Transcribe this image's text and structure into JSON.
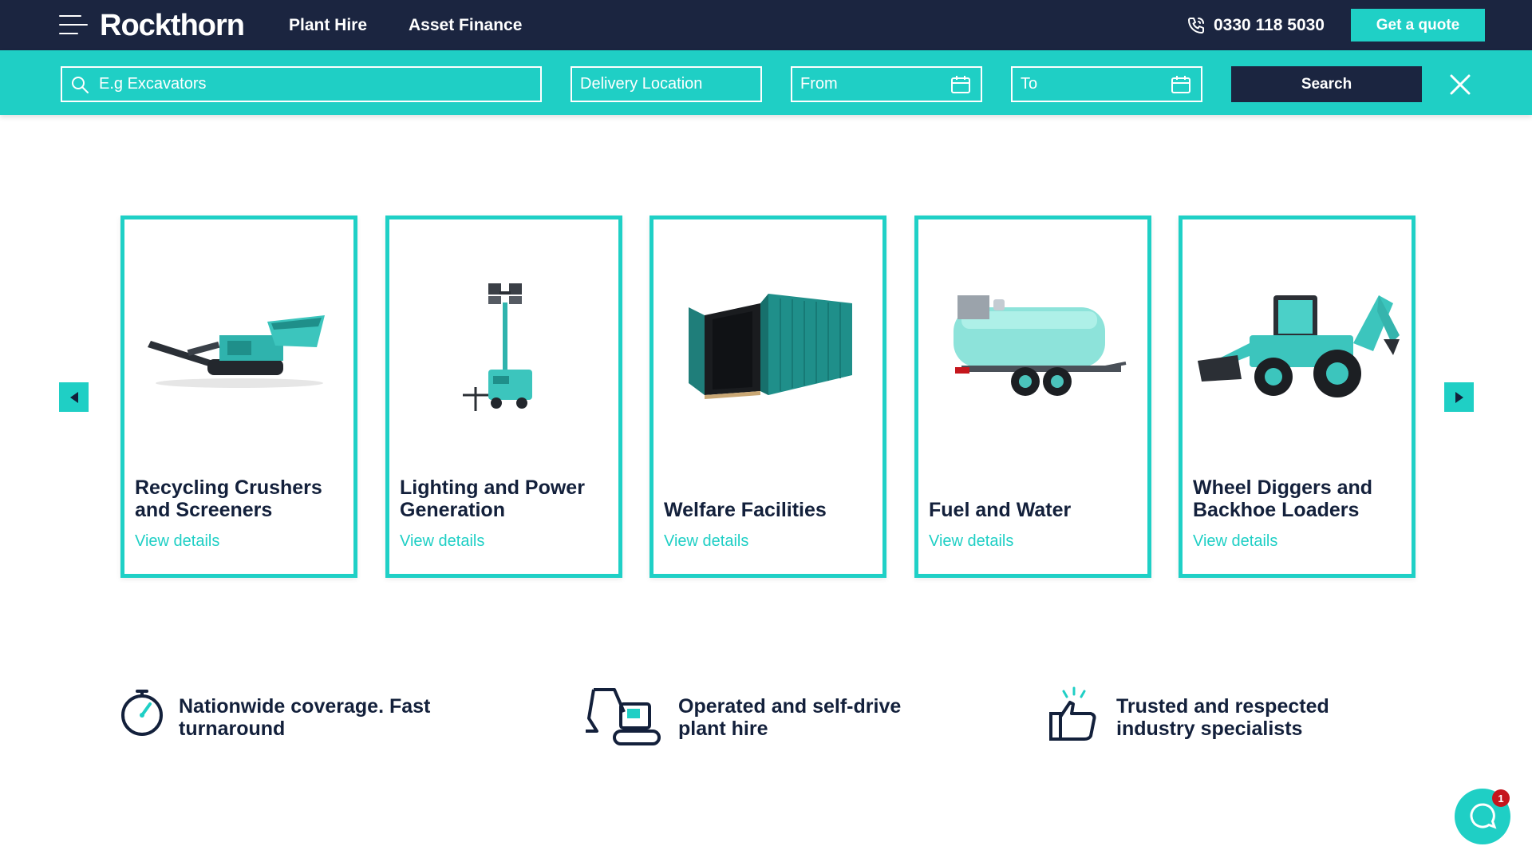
{
  "header": {
    "logo": "Rockthorn",
    "nav": [
      {
        "label": "Plant Hire"
      },
      {
        "label": "Asset Finance"
      }
    ],
    "phone": "0330 118 5030",
    "quote_label": "Get a quote"
  },
  "search": {
    "equipment_placeholder": "E.g Excavators",
    "location_placeholder": "Delivery Location",
    "from_placeholder": "From",
    "to_placeholder": "To",
    "button_label": "Search"
  },
  "carousel": {
    "cards": [
      {
        "title": "Recycling Crushers and Screeners",
        "link": "View details"
      },
      {
        "title": "Lighting and Power Generation",
        "link": "View details"
      },
      {
        "title": "Welfare Facilities",
        "link": "View details"
      },
      {
        "title": "Fuel and Water",
        "link": "View details"
      },
      {
        "title": "Wheel Diggers and Backhoe Loaders",
        "link": "View details"
      }
    ]
  },
  "features": [
    {
      "text": "Nationwide coverage. Fast turnaround"
    },
    {
      "text": "Operated and self-drive plant hire"
    },
    {
      "text": "Trusted and respected industry specialists"
    }
  ],
  "chat": {
    "badge_count": "1"
  },
  "colors": {
    "navy": "#1b2540",
    "teal": "#1fcfc5",
    "text": "#13203b"
  }
}
